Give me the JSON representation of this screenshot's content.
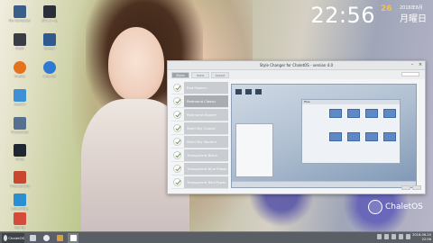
{
  "clock": {
    "time": "22:56",
    "seconds": "26",
    "date": "2016年6月",
    "weekday": "月曜日"
  },
  "desktop_icons": [
    {
      "label": "My Computer",
      "color": "#3b5d8a"
    },
    {
      "label": "ボリューム",
      "color": "#2b2f3a"
    },
    {
      "label": "Trash",
      "color": "#3a3d44"
    },
    {
      "label": "Screen",
      "color": "#2f5a8f"
    },
    {
      "label": "Firefox",
      "color": "#e4721c"
    },
    {
      "label": "Internet",
      "color": "#2f7ad0"
    },
    {
      "label": "Search",
      "color": "#3d8fd6"
    },
    {
      "label": "Translation",
      "color": "#58708f"
    },
    {
      "label": "Gimp",
      "color": "#1f2733"
    },
    {
      "label": "Thunderbird",
      "color": "#c9472f"
    },
    {
      "label": "LibreOffice",
      "color": "#2a8ed0"
    },
    {
      "label": "Set Up",
      "color": "#d44b3c"
    }
  ],
  "window": {
    "title": "Style Changer for ChaletOS - version 4.0",
    "tabs": [
      "Styles",
      "Icons",
      "Layout"
    ],
    "items": [
      "Red Modern",
      "Redmond Classic",
      "Redmond Modern",
      "Steel Sky Classic",
      "Steel Sky Modern",
      "Transparent Black Power",
      "Transparent Blue Power",
      "Transparent Red Power"
    ],
    "selected_index": 1,
    "preview_window_title": "Files",
    "ok_label": "",
    "cancel_label": ""
  },
  "branding": {
    "logo_text": "ChaletOS"
  },
  "taskbar": {
    "start_label": "ChaletOS",
    "clock_time": "22:56",
    "clock_date": "2016-06-20"
  },
  "colors": {
    "accent": "#9ea3a8",
    "taskbar": "#5a5f66"
  }
}
